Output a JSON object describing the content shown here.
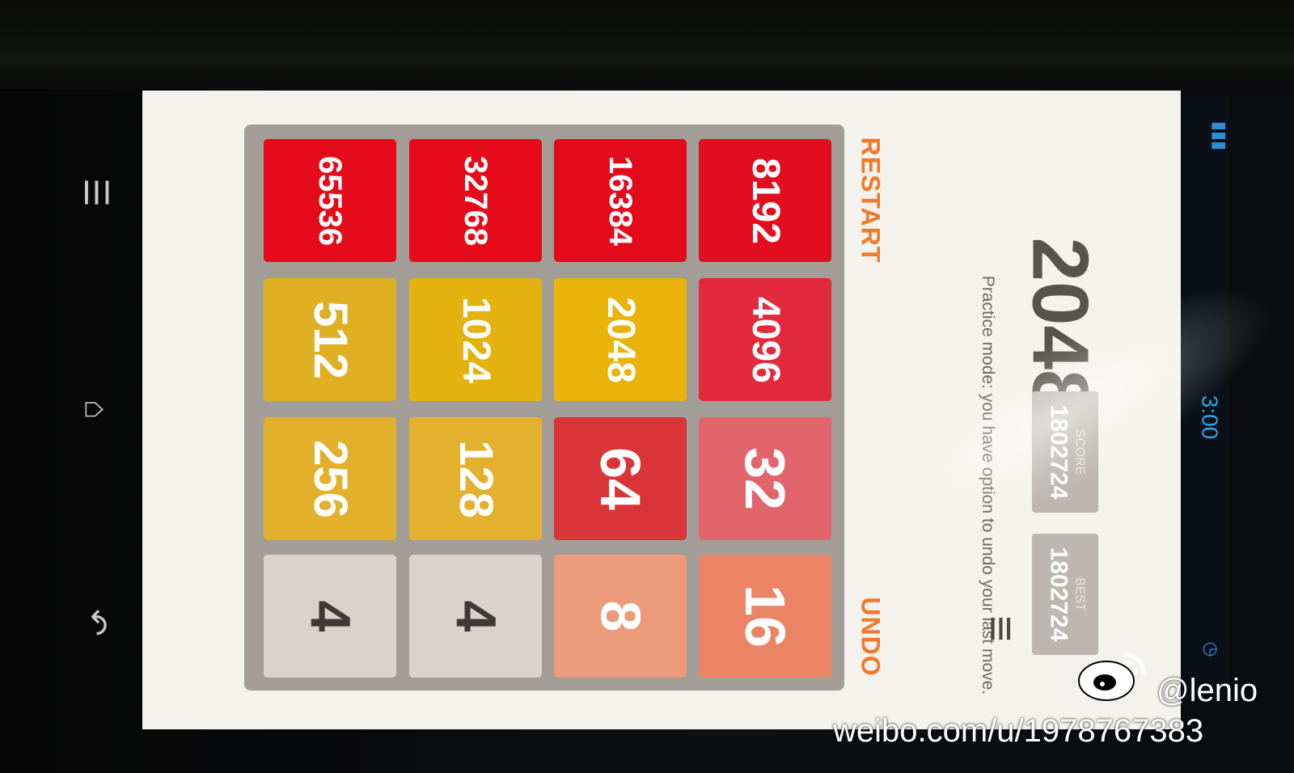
{
  "game": {
    "title": "2048",
    "subtitle": "Practice mode: you have option to undo your last move.",
    "restart_label": "RESTART",
    "undo_label": "UNDO",
    "score": {
      "label": "SCORE",
      "value": "1802724"
    },
    "best": {
      "label": "BEST",
      "value": "1802724"
    }
  },
  "board": {
    "rows": [
      [
        "8192",
        "4096",
        "32",
        "16"
      ],
      [
        "16384",
        "2048",
        "64",
        "8"
      ],
      [
        "32768",
        "1024",
        "128",
        "4"
      ],
      [
        "65536",
        "512",
        "256",
        "4"
      ]
    ]
  },
  "tile_colors": {
    "4": "#d8d3cb",
    "8": "#eb9a7a",
    "16": "#eb8464",
    "32": "#e2656c",
    "64": "#d93438",
    "128": "#e3b12d",
    "256": "#e2b02b",
    "512": "#e0b024",
    "1024": "#e3b20f",
    "2048": "#e9b30c",
    "4096": "#e22a3c",
    "8192": "#e20e20",
    "16384": "#e30b1b",
    "32768": "#e50b1a",
    "65536": "#e50b1a"
  },
  "text_colors": {
    "dark": "#3d3a37",
    "light": "#ffffff"
  },
  "accent": "#f07a2c",
  "watermark": {
    "handle": "@lenio",
    "url": "weibo.com/u/1978767383"
  },
  "status_bar": {
    "time": "3:00"
  },
  "icons": [
    "menu-icon",
    "home-icon",
    "back-icon",
    "hamburger-icon",
    "weibo-logo-icon"
  ]
}
